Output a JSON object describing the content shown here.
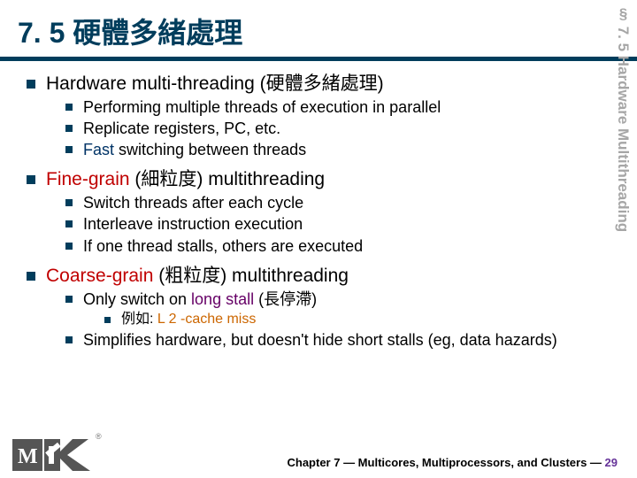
{
  "side_title": "§ 7. 5 Hardware Multithreading",
  "title": "7. 5  硬體多緒處理",
  "s1": {
    "head_a": "Hardware multi-threading",
    "head_b": " (硬體多緒處理)",
    "b1": "Performing multiple threads of execution in parallel",
    "b2": "Replicate registers, PC, etc.",
    "b3_r": "Fast",
    "b3": " switching between threads"
  },
  "s2": {
    "head_a": "Fine-grain",
    "head_b": " (細粒度) multithreading",
    "b1": "Switch threads after each cycle",
    "b2": "Interleave instruction execution",
    "b3": "If one thread stalls, others are executed"
  },
  "s3": {
    "head_a": "Coarse-grain",
    "head_b": " (粗粒度) multithreading",
    "b1_a": "Only switch on ",
    "b1_b": "long stall",
    "b1_c": " (長停滯)",
    "ex_a": "例如: ",
    "ex_b": "L 2 -cache miss",
    "b2": "Simplifies hardware, but doesn't hide short stalls (eg, data hazards)"
  },
  "footer_a": "Chapter 7 — Multicores, Multiprocessors, and Clusters — ",
  "footer_pg": "29",
  "reg": "®"
}
